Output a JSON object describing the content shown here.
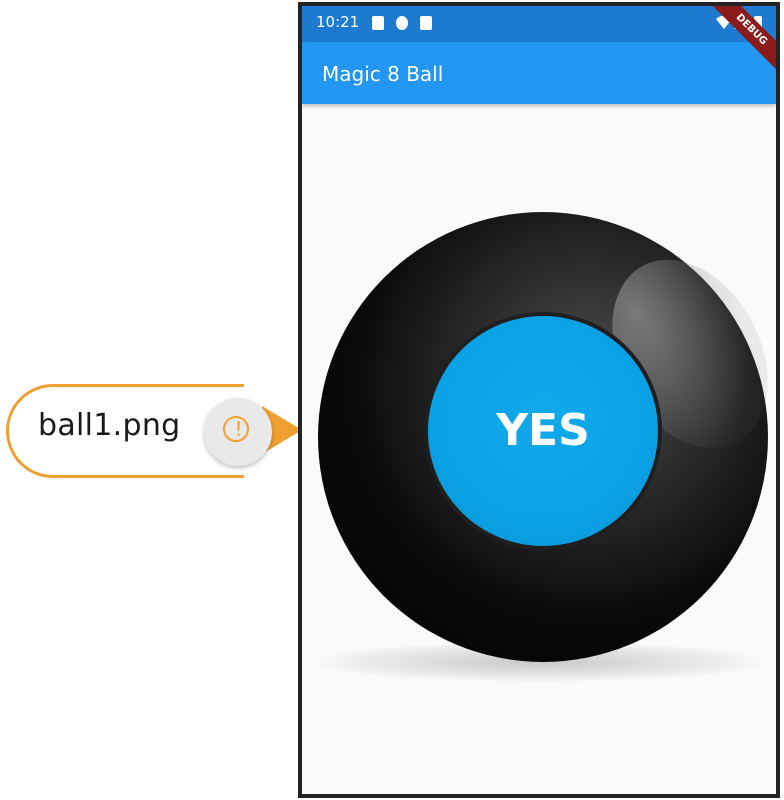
{
  "callout": {
    "label": "ball1.png",
    "badge_mark": "!"
  },
  "statusbar": {
    "time": "10:21",
    "icons": [
      "notification-a-icon",
      "notification-round-icon",
      "sd-card-icon",
      "wifi-icon",
      "signal-icon",
      "battery-icon"
    ]
  },
  "appbar": {
    "title": "Magic 8 Ball"
  },
  "debug_banner": "DEBUG",
  "ball": {
    "answer": "YES"
  },
  "colors": {
    "appbar": "#2196f3",
    "statusbar": "#1c7bd0",
    "face": "#0aa2e6",
    "callout": "#f0a030"
  }
}
